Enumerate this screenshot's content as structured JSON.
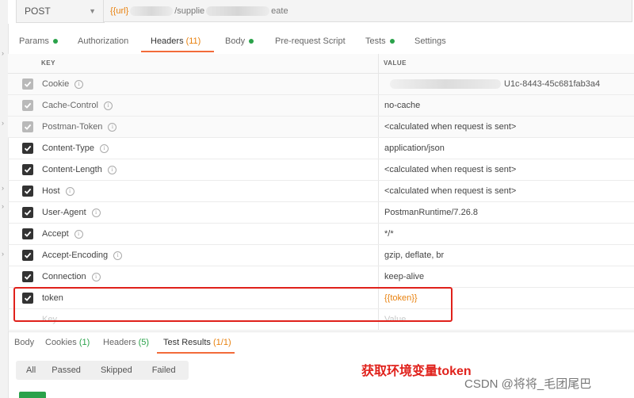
{
  "request": {
    "method": "POST",
    "url_prefix": "{{url}",
    "url_middle": "/supplie",
    "url_suffix": "eate"
  },
  "tabs": [
    {
      "label": "Params",
      "dot": true
    },
    {
      "label": "Authorization"
    },
    {
      "label": "Headers",
      "count": "(11)",
      "active": true
    },
    {
      "label": "Body",
      "dot": true
    },
    {
      "label": "Pre-request Script"
    },
    {
      "label": "Tests",
      "dot": true
    },
    {
      "label": "Settings"
    }
  ],
  "table": {
    "key_header": "KEY",
    "value_header": "VALUE",
    "rows": [
      {
        "key": "Cookie",
        "value": "U1c-8443-45c681fab3a4",
        "checked": "auto"
      },
      {
        "key": "Cache-Control",
        "value": "no-cache",
        "checked": "auto"
      },
      {
        "key": "Postman-Token",
        "value": "<calculated when request is sent>",
        "checked": "auto"
      },
      {
        "key": "Content-Type",
        "value": "application/json",
        "checked": "on"
      },
      {
        "key": "Content-Length",
        "value": "<calculated when request is sent>",
        "checked": "on"
      },
      {
        "key": "Host",
        "value": "<calculated when request is sent>",
        "checked": "on"
      },
      {
        "key": "User-Agent",
        "value": "PostmanRuntime/7.26.8",
        "checked": "on"
      },
      {
        "key": "Accept",
        "value": "*/*",
        "checked": "on"
      },
      {
        "key": "Accept-Encoding",
        "value": "gzip, deflate, br",
        "checked": "on"
      },
      {
        "key": "Connection",
        "value": "keep-alive",
        "checked": "on"
      },
      {
        "key": "token",
        "value": "{{token}}",
        "checked": "on"
      }
    ],
    "placeholder_key": "Key",
    "placeholder_value": "Value"
  },
  "response_tabs": [
    {
      "label": "Body"
    },
    {
      "label": "Cookies",
      "count": "(1)"
    },
    {
      "label": "Headers",
      "count": "(5)"
    },
    {
      "label": "Test Results",
      "count": "(1/1)",
      "active": true
    }
  ],
  "filters": [
    "All",
    "Passed",
    "Skipped",
    "Failed"
  ],
  "annotation": "获取环境变量token",
  "watermark": "CSDN @将将_毛团尾巴",
  "colors": {
    "accent": "#f26b3a",
    "annotation": "#e0211b",
    "variable": "#e8810e",
    "dot": "#2aa24a"
  }
}
